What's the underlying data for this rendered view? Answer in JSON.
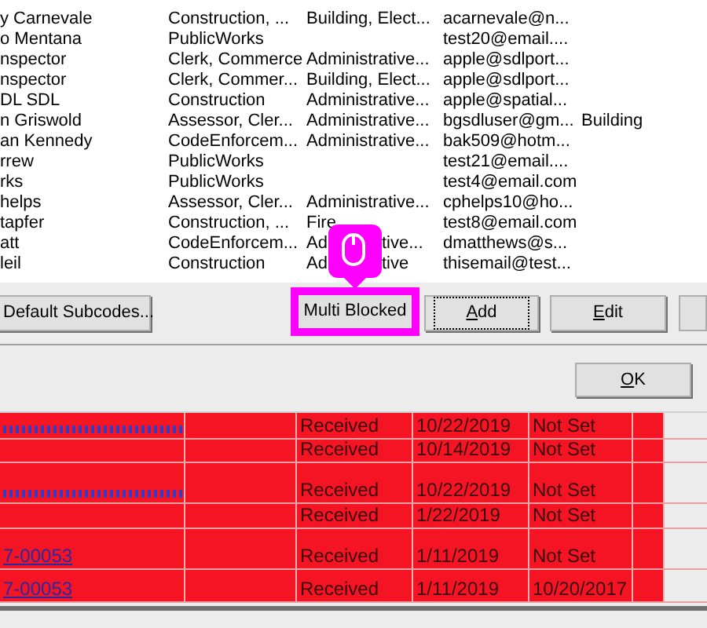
{
  "user_list": {
    "rows": [
      {
        "name": "y Carnevale",
        "roles": "Construction, ...",
        "departments": "Building, Elect...",
        "email": "acarnevale@n..."
      },
      {
        "name": "o Mentana",
        "roles": "PublicWorks",
        "email": "test20@email...."
      },
      {
        "name": "nspector",
        "roles": "Clerk, Commerce",
        "departments": "Administrative...",
        "email": "apple@sdlport..."
      },
      {
        "name": "nspector",
        "roles": "Clerk, Commer...",
        "departments": "Building, Elect...",
        "email": "apple@sdlport..."
      },
      {
        "name": "DL SDL",
        "roles": "Construction",
        "departments": "Administrative...",
        "email": "apple@spatial..."
      },
      {
        "name": "n Griswold",
        "roles": "Assessor, Cler...",
        "departments": "Administrative...",
        "email": "bgsdluser@gm...",
        "column_5": "Building"
      },
      {
        "name": "an Kennedy",
        "roles": "CodeEnforcem...",
        "departments": "Administrative...",
        "email": "bak509@hotm..."
      },
      {
        "name": "rrew",
        "roles": "PublicWorks",
        "email": "test21@email...."
      },
      {
        "name": "rks",
        "roles": "PublicWorks",
        "email": "test4@email.com"
      },
      {
        "name": "helps",
        "roles": "Assessor, Cler...",
        "departments": "Administrative...",
        "email": "cphelps10@ho..."
      },
      {
        "name": "tapfer",
        "roles": "Construction, ...",
        "departments": "Fire",
        "email": "test8@email.com"
      },
      {
        "name": "att",
        "roles": "CodeEnforcem...",
        "departments": "Ad",
        "departments_tail": "tive...",
        "email": "dmatthews@s..."
      },
      {
        "name": "leil",
        "roles": "Construction",
        "departments": "Ad",
        "departments_tail": "tive",
        "email": "thisemail@test..."
      }
    ]
  },
  "buttons": [
    {
      "kind": "plain",
      "label": "Default Subcodes...",
      "highlighted": false,
      "focused": false
    },
    {
      "kind": "plain",
      "label": "Multi Blocked",
      "highlighted": true,
      "focused": false
    },
    {
      "kind": "mnemonic",
      "key": "A",
      "rest": "dd",
      "highlighted": false,
      "focused": true
    },
    {
      "kind": "mnemonic",
      "key": "E",
      "rest": "dit",
      "highlighted": false,
      "focused": false
    },
    {
      "kind": "cut"
    }
  ],
  "ok_button": {
    "key": "O",
    "rest": "K"
  },
  "records": {
    "rows": [
      {
        "link_obscured": true,
        "status": "Received",
        "date": "10/22/2019",
        "column_7": "Not Set"
      },
      {
        "link_obscured": false,
        "status": "Received",
        "date": "10/14/2019",
        "column_7": "Not Set"
      },
      {
        "link_obscured": true,
        "status": "Received",
        "date": "10/22/2019",
        "column_7": "Not Set"
      },
      {
        "link_obscured": false,
        "status": "Received",
        "date": "1/22/2019",
        "column_7": "Not Set"
      },
      {
        "link_obscured": false,
        "link": "7-00053",
        "status": "Received",
        "date": "1/11/2019",
        "column_7": "Not Set"
      },
      {
        "link_obscured": false,
        "link": "7-00053",
        "status": "Received",
        "date": "1/11/2019",
        "column_7": "10/20/2017"
      }
    ]
  }
}
